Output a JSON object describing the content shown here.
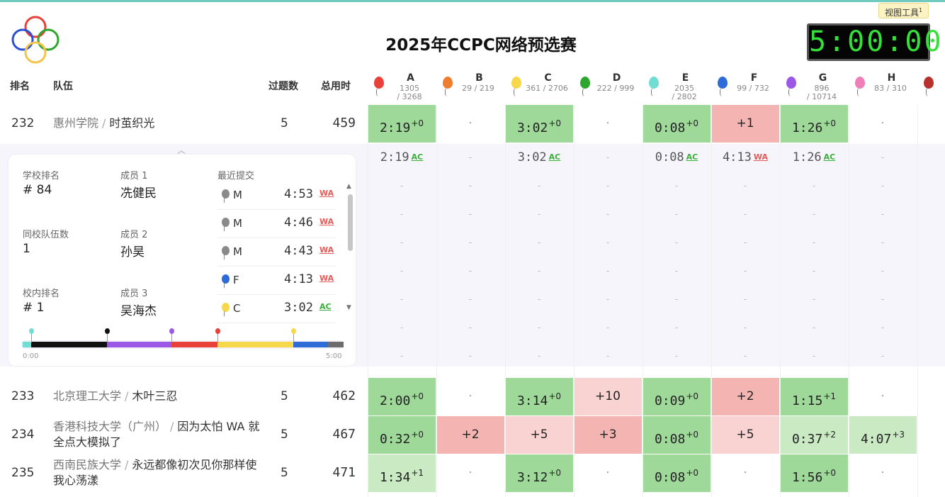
{
  "contest": {
    "title": "2025年CCPC网络预选赛",
    "clock": "5:00:00",
    "view_tools": "视图工具",
    "view_tools_sup": "1"
  },
  "headers": {
    "rank": "排名",
    "team": "队伍",
    "solved": "过题数",
    "penalty": "总用时"
  },
  "problems": [
    {
      "letter": "A",
      "stat1": "1305",
      "stat2": "/ 3268",
      "color": "#e8413a"
    },
    {
      "letter": "B",
      "stat1": "29 / 219",
      "stat2": "",
      "color": "#ef7d30"
    },
    {
      "letter": "C",
      "stat1": "361 / 2706",
      "stat2": "",
      "color": "#f7d84a"
    },
    {
      "letter": "D",
      "stat1": "222 / 999",
      "stat2": "",
      "color": "#2ea52c"
    },
    {
      "letter": "E",
      "stat1": "2035",
      "stat2": "/ 2802",
      "color": "#72ddd2"
    },
    {
      "letter": "F",
      "stat1": "99 / 732",
      "stat2": "",
      "color": "#2d6bd6"
    },
    {
      "letter": "G",
      "stat1": "896",
      "stat2": "/ 10714",
      "color": "#9b58e6"
    },
    {
      "letter": "H",
      "stat1": "83 / 310",
      "stat2": "",
      "color": "#ee7fb9"
    },
    {
      "letter": "",
      "stat1": "",
      "stat2": "",
      "color": "#b7322e"
    }
  ],
  "rows": [
    {
      "rank": "232",
      "school": "惠州学院",
      "team": "时茧织光",
      "solved": "5",
      "penalty": "459",
      "cells": [
        {
          "s": "ac",
          "t": "2:19",
          "tr": "+0"
        },
        {
          "s": "none",
          "x": "·"
        },
        {
          "s": "ac",
          "t": "3:02",
          "tr": "+0"
        },
        {
          "s": "none",
          "x": "·"
        },
        {
          "s": "ac",
          "t": "0:08",
          "tr": "+0"
        },
        {
          "s": "wa",
          "x": "+1"
        },
        {
          "s": "ac",
          "t": "1:26",
          "tr": "+0"
        },
        {
          "s": "none",
          "x": "·"
        }
      ]
    },
    {
      "rank": "233",
      "school": "北京理工大学",
      "team": "木叶三忍",
      "solved": "5",
      "penalty": "462",
      "cells": [
        {
          "s": "ac",
          "t": "2:00",
          "tr": "+0"
        },
        {
          "s": "none",
          "x": "·"
        },
        {
          "s": "ac",
          "t": "3:14",
          "tr": "+0"
        },
        {
          "s": "wal",
          "x": "+10"
        },
        {
          "s": "ac",
          "t": "0:09",
          "tr": "+0"
        },
        {
          "s": "wa",
          "x": "+2"
        },
        {
          "s": "ac",
          "t": "1:15",
          "tr": "+1"
        },
        {
          "s": "none",
          "x": "·"
        }
      ]
    },
    {
      "rank": "234",
      "school": "香港科技大学（广州）",
      "team": "因为太怕 WA 就全点大模拟了",
      "solved": "5",
      "penalty": "467",
      "cells": [
        {
          "s": "ac",
          "t": "0:32",
          "tr": "+0"
        },
        {
          "s": "wa",
          "x": "+2"
        },
        {
          "s": "wal",
          "x": "+5"
        },
        {
          "s": "wa",
          "x": "+3"
        },
        {
          "s": "ac",
          "t": "0:08",
          "tr": "+0"
        },
        {
          "s": "wal",
          "x": "+5"
        },
        {
          "s": "acl",
          "t": "0:37",
          "tr": "+2"
        },
        {
          "s": "acl",
          "t": "4:07",
          "tr": "+3"
        }
      ]
    },
    {
      "rank": "235",
      "school": "西南民族大学",
      "team": "永远都像初次见你那样使我心荡漾",
      "solved": "5",
      "penalty": "471",
      "cells": [
        {
          "s": "acl",
          "t": "1:34",
          "tr": "+1"
        },
        {
          "s": "none",
          "x": "·"
        },
        {
          "s": "ac",
          "t": "3:12",
          "tr": "+0"
        },
        {
          "s": "none",
          "x": "·"
        },
        {
          "s": "ac",
          "t": "0:08",
          "tr": "+0"
        },
        {
          "s": "none",
          "x": "·"
        },
        {
          "s": "ac",
          "t": "1:56",
          "tr": "+0"
        },
        {
          "s": "none",
          "x": "·"
        }
      ]
    }
  ],
  "detail": {
    "school_rank_label": "学校排名",
    "school_rank": "# 84",
    "same_school_label": "同校队伍数",
    "same_school": "1",
    "inner_rank_label": "校内排名",
    "inner_rank": "# 1",
    "member1_label": "成员 1",
    "member1": "冼健民",
    "member2_label": "成员 2",
    "member2": "孙昊",
    "member3_label": "成员 3",
    "member3": "吴海杰",
    "recent_label": "最近提交",
    "submissions": [
      {
        "p": "M",
        "time": "4:53",
        "verdict": "WA",
        "color": "#8a8a8a"
      },
      {
        "p": "M",
        "time": "4:46",
        "verdict": "WA",
        "color": "#8a8a8a"
      },
      {
        "p": "M",
        "time": "4:43",
        "verdict": "WA",
        "color": "#8a8a8a"
      },
      {
        "p": "F",
        "time": "4:13",
        "verdict": "WA",
        "color": "#2d6bd6"
      },
      {
        "p": "C",
        "time": "3:02",
        "verdict": "AC",
        "color": "#f7d84a"
      }
    ],
    "timeline_start": "0:00",
    "timeline_end": "5:00",
    "timeline": [
      {
        "from": 0,
        "to": 8,
        "color": "#72ddd2"
      },
      {
        "from": 8,
        "to": 79,
        "color": "#111111"
      },
      {
        "from": 79,
        "to": 139,
        "color": "#9b58e6"
      },
      {
        "from": 139,
        "to": 182,
        "color": "#e8413a"
      },
      {
        "from": 182,
        "to": 253,
        "color": "#f7d84a"
      },
      {
        "from": 253,
        "to": 300,
        "color": "#2d6bd6"
      }
    ],
    "timeline_gray_from": 253,
    "pins": [
      {
        "at": 8,
        "color": "#72ddd2"
      },
      {
        "at": 79,
        "color": "#111111"
      },
      {
        "at": 139,
        "color": "#9b58e6"
      },
      {
        "at": 182,
        "color": "#e8413a"
      },
      {
        "at": 253,
        "color": "#f7d84a"
      }
    ],
    "timeline_minutes": 300,
    "problem_detail": [
      {
        "t": "2:19",
        "v": "AC"
      },
      {
        "t": "",
        "v": ""
      },
      {
        "t": "3:02",
        "v": "AC"
      },
      {
        "t": "",
        "v": ""
      },
      {
        "t": "0:08",
        "v": "AC"
      },
      {
        "t": "4:13",
        "v": "WA"
      },
      {
        "t": "1:26",
        "v": "AC"
      },
      {
        "t": "",
        "v": ""
      }
    ],
    "empty_mark": "-"
  }
}
